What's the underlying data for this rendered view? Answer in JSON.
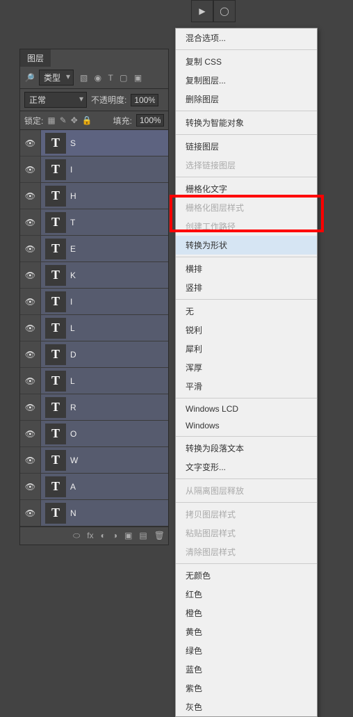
{
  "top_tools": {
    "play": "▶",
    "lasso": "◯"
  },
  "panel": {
    "tab": "图层",
    "filter_label": "类型",
    "icons": {
      "img": "▧",
      "fx": "◉",
      "T": "T",
      "shape": "▢",
      "smart": "▣"
    },
    "blend_mode": "正常",
    "opacity_label": "不透明度:",
    "opacity_value": "100%",
    "lock_label": "锁定:",
    "fill_label": "填充:",
    "fill_value": "100%"
  },
  "layers": [
    {
      "name": "S"
    },
    {
      "name": "I"
    },
    {
      "name": "H"
    },
    {
      "name": "T"
    },
    {
      "name": "E"
    },
    {
      "name": "K"
    },
    {
      "name": "I"
    },
    {
      "name": "L"
    },
    {
      "name": "D"
    },
    {
      "name": "L"
    },
    {
      "name": "R"
    },
    {
      "name": "O"
    },
    {
      "name": "W"
    },
    {
      "name": "A"
    },
    {
      "name": "N"
    }
  ],
  "footer_icons": {
    "link": "⬭",
    "fx": "fx",
    "mask": "◐",
    "adj": "◑",
    "group": "▣",
    "new": "▤",
    "trash": "🗑"
  },
  "menu": [
    {
      "t": "混合选项...",
      "e": true
    },
    {
      "sep": true
    },
    {
      "t": "复制 CSS",
      "e": true
    },
    {
      "t": "复制图层...",
      "e": true
    },
    {
      "t": "删除图层",
      "e": true
    },
    {
      "sep": true
    },
    {
      "t": "转换为智能对象",
      "e": true
    },
    {
      "sep": true
    },
    {
      "t": "链接图层",
      "e": true
    },
    {
      "t": "选择链接图层",
      "e": false
    },
    {
      "sep": true
    },
    {
      "t": "栅格化文字",
      "e": true
    },
    {
      "t": "栅格化图层样式",
      "e": false
    },
    {
      "t": "创建工作路径",
      "e": false
    },
    {
      "t": "转换为形状",
      "e": true,
      "hover": true
    },
    {
      "sep": true
    },
    {
      "t": "横排",
      "e": true
    },
    {
      "t": "竖排",
      "e": true
    },
    {
      "sep": true
    },
    {
      "t": "无",
      "e": true
    },
    {
      "t": "锐利",
      "e": true
    },
    {
      "t": "犀利",
      "e": true
    },
    {
      "t": "浑厚",
      "e": true
    },
    {
      "t": "平滑",
      "e": true
    },
    {
      "sep": true
    },
    {
      "t": "Windows LCD",
      "e": true
    },
    {
      "t": "Windows",
      "e": true
    },
    {
      "sep": true
    },
    {
      "t": "转换为段落文本",
      "e": true
    },
    {
      "t": "文字变形...",
      "e": true
    },
    {
      "sep": true
    },
    {
      "t": "从隔离图层释放",
      "e": false
    },
    {
      "sep": true
    },
    {
      "t": "拷贝图层样式",
      "e": false
    },
    {
      "t": "粘贴图层样式",
      "e": false
    },
    {
      "t": "清除图层样式",
      "e": false
    },
    {
      "sep": true
    },
    {
      "t": "无颜色",
      "e": true
    },
    {
      "t": "红色",
      "e": true
    },
    {
      "t": "橙色",
      "e": true
    },
    {
      "t": "黄色",
      "e": true
    },
    {
      "t": "绿色",
      "e": true
    },
    {
      "t": "蓝色",
      "e": true
    },
    {
      "t": "紫色",
      "e": true
    },
    {
      "t": "灰色",
      "e": true
    }
  ]
}
